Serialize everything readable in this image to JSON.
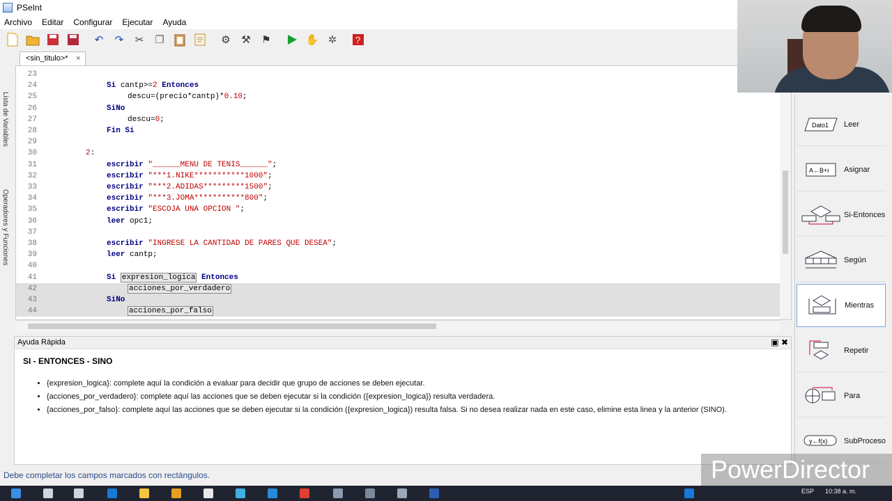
{
  "window": {
    "title": "PSeInt"
  },
  "menu": [
    "Archivo",
    "Editar",
    "Configurar",
    "Ejecutar",
    "Ayuda"
  ],
  "toolbar_icons": [
    "new-file-icon",
    "open-folder-icon",
    "save-icon",
    "save-as-icon",
    "undo-icon",
    "redo-icon",
    "cut-icon",
    "copy-icon",
    "paste-icon",
    "indent-icon",
    "run-step-icon",
    "debug-icon",
    "diagram-icon",
    "run-icon",
    "step-icon",
    "flowchart-icon",
    "help-icon"
  ],
  "left_panel": {
    "variables_label": "Lista de Variables",
    "operators_label": "Operadores y Funciones"
  },
  "tab": {
    "label": "<sin_titulo>*",
    "close": "×"
  },
  "editor": {
    "lines": [
      {
        "n": "23",
        "segments": []
      },
      {
        "n": "24",
        "segments": [
          [
            "kw",
            "Si "
          ],
          [
            "t",
            "cantp>="
          ],
          [
            "num",
            "2"
          ],
          [
            "kw",
            " Entonces"
          ]
        ]
      },
      {
        "n": "25",
        "segments": [
          [
            "t",
            "descu=(precio*cantp)*"
          ],
          [
            "num",
            "0.10"
          ],
          [
            "t",
            ";"
          ]
        ]
      },
      {
        "n": "26",
        "segments": [
          [
            "kw",
            "SiNo"
          ]
        ]
      },
      {
        "n": "27",
        "segments": [
          [
            "t",
            "descu="
          ],
          [
            "num",
            "0"
          ],
          [
            "t",
            ";"
          ]
        ]
      },
      {
        "n": "28",
        "segments": [
          [
            "kw",
            "Fin Si"
          ]
        ]
      },
      {
        "n": "29",
        "segments": []
      },
      {
        "n": "30",
        "segments": [
          [
            "num",
            "2"
          ],
          [
            "t",
            ":"
          ]
        ]
      },
      {
        "n": "31",
        "segments": [
          [
            "kw",
            "escribir "
          ],
          [
            "str",
            "\"______MENU DE TENIS______\""
          ],
          [
            "t",
            ";"
          ]
        ]
      },
      {
        "n": "32",
        "segments": [
          [
            "kw",
            "escribir "
          ],
          [
            "str",
            "\"***1.NIKE***********1000\""
          ],
          [
            "t",
            ";"
          ]
        ]
      },
      {
        "n": "33",
        "segments": [
          [
            "kw",
            "escribir "
          ],
          [
            "str",
            "\"***2.ADIDAS*********1500\""
          ],
          [
            "t",
            ";"
          ]
        ]
      },
      {
        "n": "34",
        "segments": [
          [
            "kw",
            "escribir "
          ],
          [
            "str",
            "\"***3.JOMA***********800\""
          ],
          [
            "t",
            ";"
          ]
        ]
      },
      {
        "n": "35",
        "segments": [
          [
            "kw",
            "escribir "
          ],
          [
            "str",
            "\"ESCOJA UNA OPCION \""
          ],
          [
            "t",
            ";"
          ]
        ]
      },
      {
        "n": "36",
        "segments": [
          [
            "kw",
            "leer "
          ],
          [
            "t",
            "opc1;"
          ]
        ]
      },
      {
        "n": "37",
        "segments": []
      },
      {
        "n": "38",
        "segments": [
          [
            "kw",
            "escribir "
          ],
          [
            "str",
            "\"INGRESE LA CANTIDAD DE PARES QUE DESEA\""
          ],
          [
            "t",
            ";"
          ]
        ]
      },
      {
        "n": "39",
        "segments": [
          [
            "kw",
            "leer "
          ],
          [
            "t",
            "cantp;"
          ]
        ]
      },
      {
        "n": "40",
        "segments": []
      },
      {
        "n": "41",
        "segments": [
          [
            "kw",
            "Si "
          ],
          [
            "ph",
            "expresion_logica"
          ],
          [
            "kw",
            " Entonces"
          ]
        ]
      },
      {
        "n": "42",
        "segments": [
          [
            "ph",
            "acciones_por_verdadero"
          ]
        ]
      },
      {
        "n": "43",
        "segments": [
          [
            "kw",
            "SiNo"
          ]
        ]
      },
      {
        "n": "44",
        "segments": [
          [
            "ph",
            "acciones_por_falso"
          ]
        ]
      }
    ]
  },
  "help": {
    "header": "Ayuda Rápida",
    "title": "SI - ENTONCES - SINO",
    "bullets": [
      "{expresion_logica}: complete aquí la condición a evaluar para decidir que grupo de acciones se deben ejecutar.",
      "{acciones_por_verdadero}: complete aquí las acciones que se deben ejecutar si la condición ({expresion_logica}) resulta verdadera.",
      "{acciones_por_falso}: complete aquí las acciones que se deben ejecutar si la condición ({expresion_logica}) resulta falsa. Si no desea realizar nada en este caso, elimine esta linea y la anterior (SINO)."
    ]
  },
  "status": "Debe completar los campos marcados con rectángulos.",
  "palette": [
    {
      "label": "Leer",
      "icon": "leer-icon",
      "icon_text": "Dato1"
    },
    {
      "label": "Asignar",
      "icon": "asignar-icon",
      "icon_text": "A←B+i"
    },
    {
      "label": "Si-Entonces",
      "icon": "si-entonces-icon"
    },
    {
      "label": "Según",
      "icon": "segun-icon"
    },
    {
      "label": "Mientras",
      "icon": "mientras-icon"
    },
    {
      "label": "Repetir",
      "icon": "repetir-icon"
    },
    {
      "label": "Para",
      "icon": "para-icon"
    },
    {
      "label": "SubProceso",
      "icon": "subproceso-icon",
      "icon_text": "y←f(x)"
    }
  ],
  "watermark": "PowerDirector",
  "tray": {
    "lang": "ESP",
    "time": "10:38 a. m."
  }
}
